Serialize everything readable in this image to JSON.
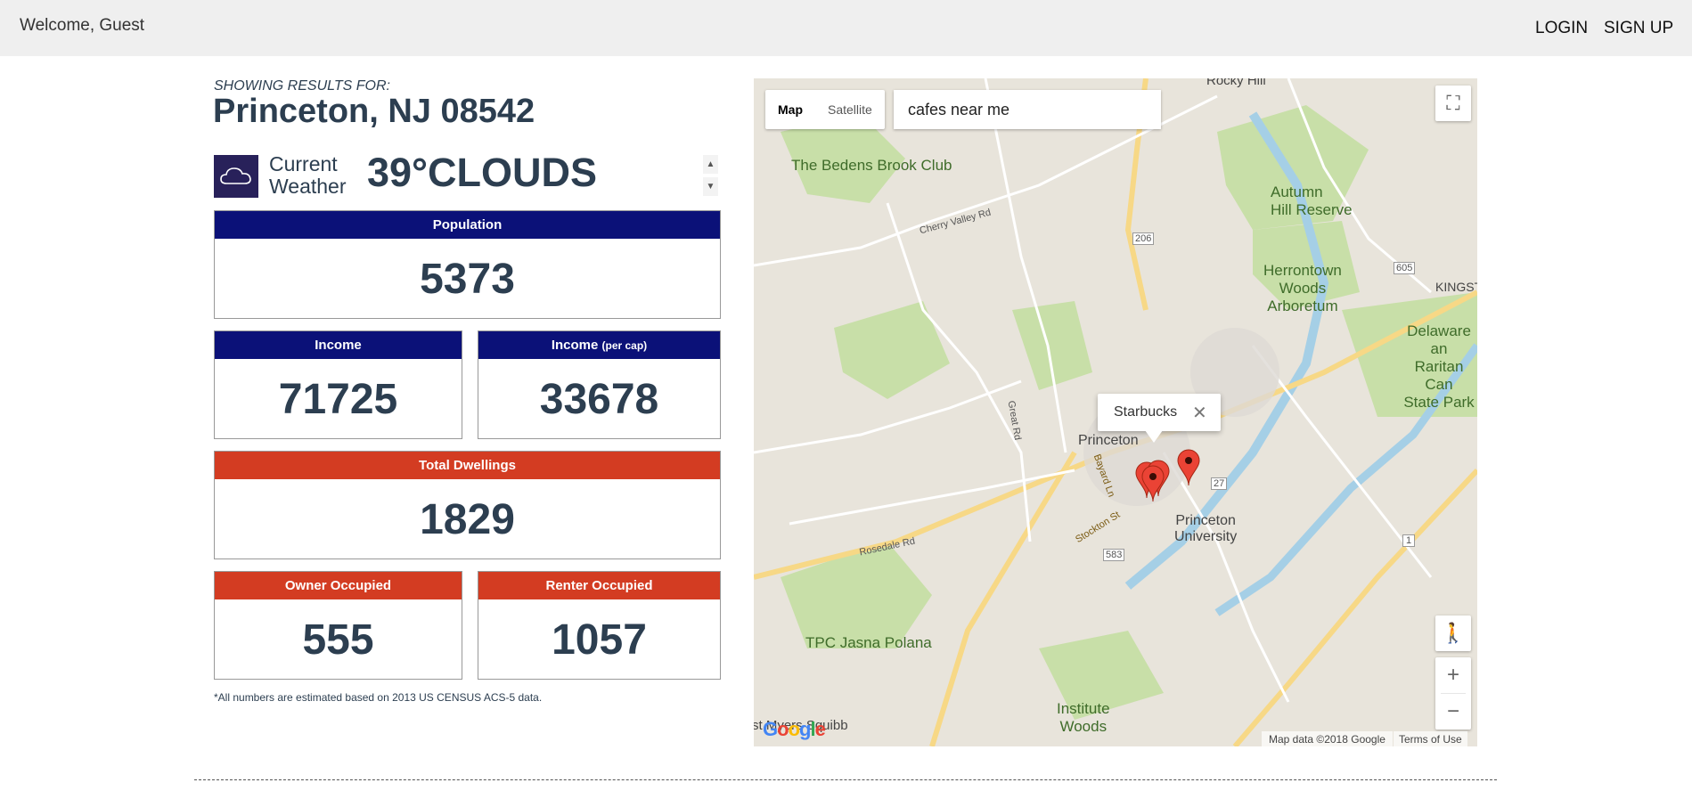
{
  "header": {
    "welcome": "Welcome, Guest",
    "login": "LOGIN",
    "signup": "SIGN UP"
  },
  "location": {
    "showing_label": "SHOWING RESULTS FOR:",
    "place": "Princeton, NJ 08542"
  },
  "weather": {
    "icon": "cloud-icon",
    "label_line1": "Current",
    "label_line2": "Weather",
    "value": "39°CLOUDS"
  },
  "stats": {
    "population": {
      "label": "Population",
      "value": "5373"
    },
    "income": {
      "label": "Income",
      "value": "71725"
    },
    "income_per_cap": {
      "label": "Income",
      "label_small": "(per cap)",
      "value": "33678"
    },
    "total_dwellings": {
      "label": "Total Dwellings",
      "value": "1829"
    },
    "owner_occupied": {
      "label": "Owner Occupied",
      "value": "555"
    },
    "renter_occupied": {
      "label": "Renter Occupied",
      "value": "1057"
    }
  },
  "footnote": "*All numbers are estimated based on 2013 US CENSUS ACS-5 data.",
  "colors": {
    "navy_header": "#0b1178",
    "red_header": "#d33c22",
    "weather_icon_bg": "#28215a",
    "text": "#2c3e50"
  },
  "map": {
    "type_map": "Map",
    "type_satellite": "Satellite",
    "search_value": "cafes near me",
    "info_window": "Starbucks",
    "close_glyph": "✕",
    "fullscreen_glyph": "⛶",
    "pegman_glyph": "🚶",
    "zoom_in": "+",
    "zoom_out": "−",
    "attribution": "Map data ©2018 Google",
    "terms": "Terms of Use",
    "logo": "Google",
    "labels": {
      "bedens": "The Bedens Brook Club",
      "autumn1": "Autumn",
      "autumn2": "Hill Reserve",
      "herron1": "Herrontown",
      "herron2": "Woods",
      "herron3": "Arboretum",
      "delaware1": "Delaware an",
      "delaware2": "Raritan Can",
      "delaware3": "State Park",
      "kingston": "KINGSTO",
      "princeton": "Princeton",
      "univ1": "Princeton",
      "univ2": "University",
      "tpc": "TPC Jasna Polana",
      "institute1": "Institute",
      "institute2": "Woods",
      "rocky": "Rocky Hill",
      "squibb": "st Myers Squibb",
      "cherry": "Cherry Valley Rd",
      "stockton": "Stockton St",
      "bayard": "Bayard Ln",
      "rosedale": "Rosedale Rd",
      "great": "Great Rd",
      "r206": "206",
      "r27": "27",
      "r583": "583",
      "r605": "605",
      "r1": "1"
    }
  }
}
